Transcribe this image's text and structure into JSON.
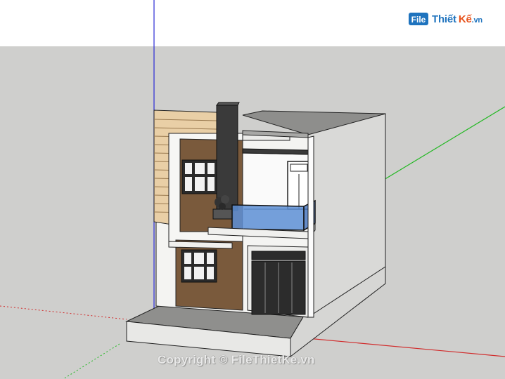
{
  "watermark": {
    "logo_mark": "File",
    "logo_word1": "Thiết",
    "logo_word2": "Kế",
    "logo_tld": ".vn",
    "copyright": "Copyright © FileThietKe.vn"
  },
  "icons": {
    "logo": "file-thiet-ke-logo-icon"
  },
  "colors": {
    "ground": "#cfcfcd",
    "sky": "#ffffff",
    "axis_blue": "#2b2bd6",
    "axis_green": "#22b822",
    "axis_red": "#d12b2b",
    "wood": "#7a5a3c",
    "glass": "#5d8fd6",
    "brand_blue": "#1e73be",
    "brand_orange": "#e8541e"
  }
}
